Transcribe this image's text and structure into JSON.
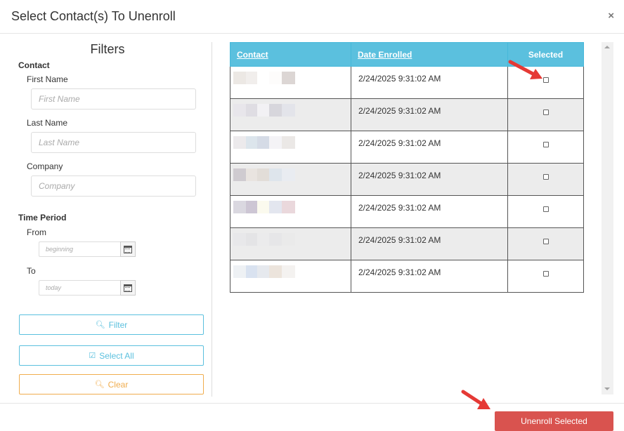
{
  "modal": {
    "title": "Select Contact(s) To Unenroll",
    "close": "×"
  },
  "filters": {
    "title": "Filters",
    "contact_section": "Contact",
    "first_name_label": "First Name",
    "first_name_placeholder": "First Name",
    "last_name_label": "Last Name",
    "last_name_placeholder": "Last Name",
    "company_label": "Company",
    "company_placeholder": "Company",
    "time_section": "Time Period",
    "from_label": "From",
    "from_placeholder": "beginning",
    "to_label": "To",
    "to_placeholder": "today",
    "filter_button": "Filter",
    "select_all_button": "Select All",
    "clear_button": "Clear"
  },
  "table": {
    "headers": [
      "Contact",
      "Date Enrolled",
      "Selected"
    ],
    "rows": [
      {
        "date": "2/24/2025 9:31:02 AM",
        "selected": false
      },
      {
        "date": "2/24/2025 9:31:02 AM",
        "selected": false
      },
      {
        "date": "2/24/2025 9:31:02 AM",
        "selected": false
      },
      {
        "date": "2/24/2025 9:31:02 AM",
        "selected": false
      },
      {
        "date": "2/24/2025 9:31:02 AM",
        "selected": false
      },
      {
        "date": "2/24/2025 9:31:02 AM",
        "selected": false
      },
      {
        "date": "2/24/2025 9:31:02 AM",
        "selected": false
      }
    ]
  },
  "footer": {
    "unenroll_button": "Unenroll Selected"
  },
  "colors": {
    "info": "#5bc0de",
    "warning": "#f0ad4e",
    "danger": "#d9534f",
    "annotation_arrow": "#e53935"
  },
  "icons": [
    "close-icon",
    "calendar-icon",
    "search-icon",
    "check-square-icon",
    "annotation-arrow-icon"
  ]
}
